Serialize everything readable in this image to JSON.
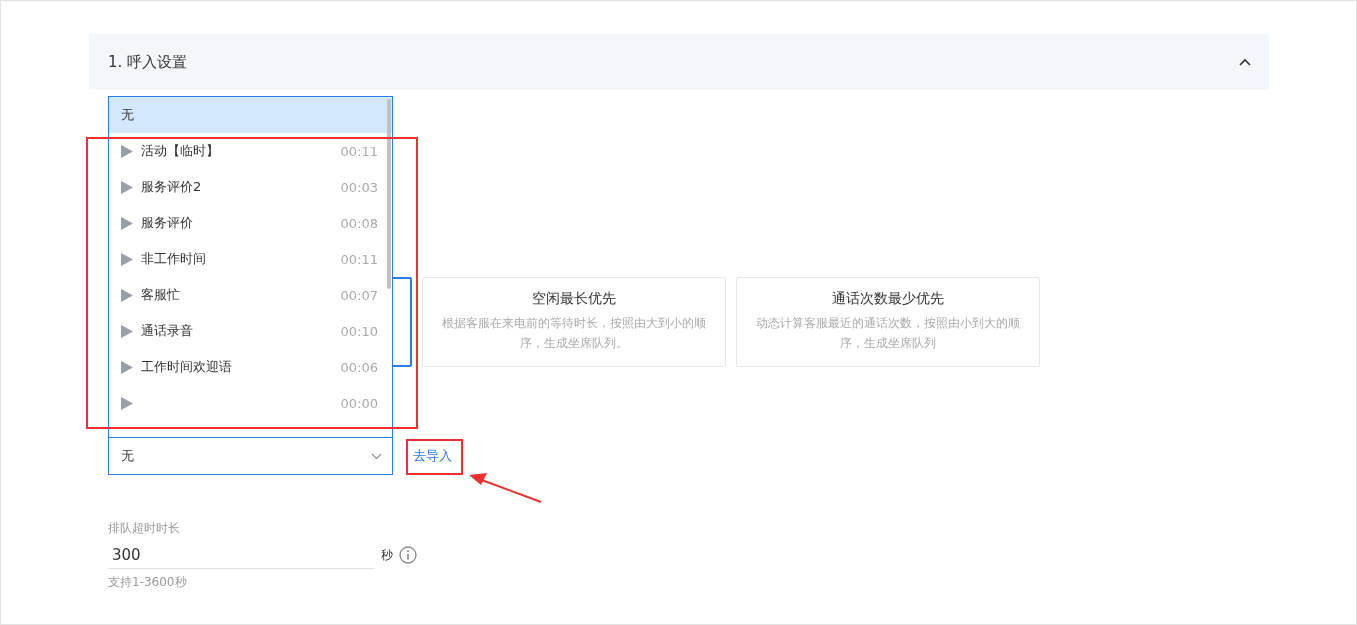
{
  "section": {
    "title": "1. 呼入设置",
    "expanded": true
  },
  "strategies": [
    {
      "selected": true
    },
    {
      "title": "空闲最长优先",
      "description": "根据客服在来电前的等待时长，按照由大到小的顺序，生成坐席队列。",
      "selected": false
    },
    {
      "title": "通话次数最少优先",
      "description": "动态计算客服最近的通话次数，按照由小到大的顺序，生成坐席队列",
      "selected": false
    }
  ],
  "audio_select": {
    "value": "无",
    "link": "去导入",
    "options": [
      {
        "kind": "none",
        "label": "无",
        "selected": true
      },
      {
        "kind": "audio",
        "label": "活动【临时】",
        "duration": "00:11",
        "selected": false
      },
      {
        "kind": "audio",
        "label": "服务评价2",
        "duration": "00:03",
        "selected": false
      },
      {
        "kind": "audio",
        "label": "服务评价",
        "duration": "00:08",
        "selected": false
      },
      {
        "kind": "audio",
        "label": "非工作时间",
        "duration": "00:11",
        "selected": false
      },
      {
        "kind": "audio",
        "label": "客服忙",
        "duration": "00:07",
        "selected": false
      },
      {
        "kind": "audio",
        "label": "通话录音",
        "duration": "00:10",
        "selected": false
      },
      {
        "kind": "audio",
        "label": "工作时间欢迎语",
        "duration": "00:06",
        "selected": false
      },
      {
        "kind": "audio",
        "duration": "00:00",
        "selected": false
      }
    ]
  },
  "queue_timeout": {
    "label": "排队超时时长",
    "value": "300",
    "unit": "秒",
    "hint": "支持1-3600秒"
  }
}
